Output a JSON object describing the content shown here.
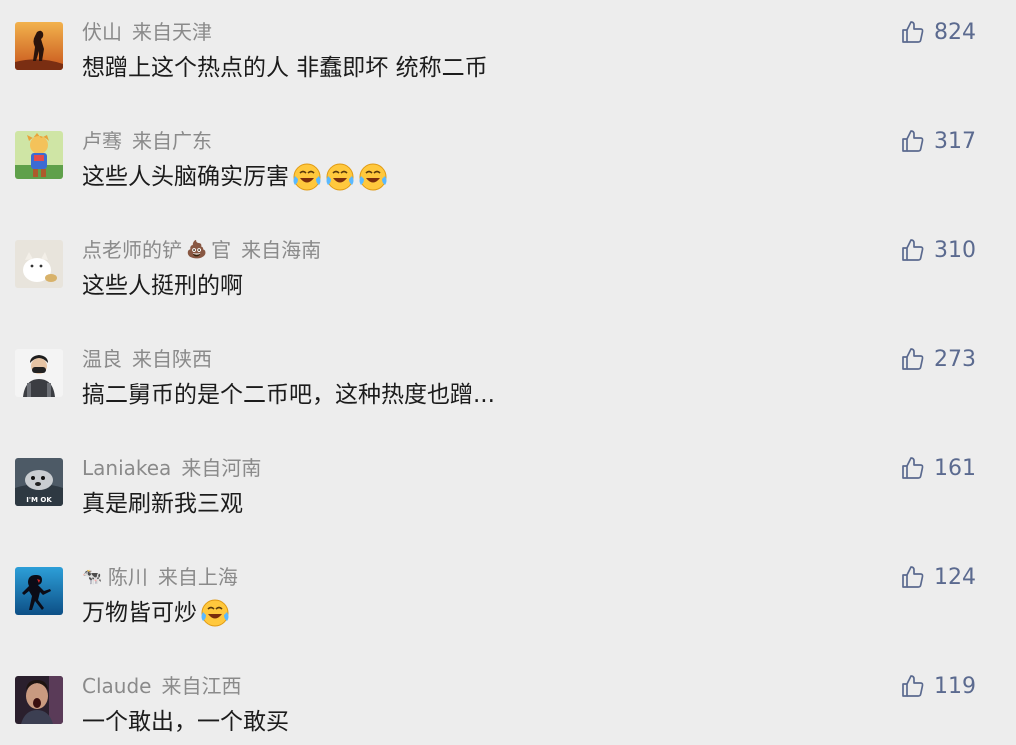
{
  "colors": {
    "background": "#ededed",
    "username": "#8a8a8a",
    "comment_text": "#1c1c1c",
    "like": "#5b6a8f"
  },
  "comments": [
    {
      "username": "伏山",
      "location": "来自天津",
      "text": "想蹭上这个热点的人 非蠢即坏 统称二币",
      "likes": "824",
      "avatar_icon": "desert-silhouette-avatar",
      "emojis": 0
    },
    {
      "username": "卢骞",
      "location": "来自广东",
      "text": "这些人头脑确实厉害",
      "likes": "317",
      "avatar_icon": "anime-character-avatar",
      "emojis": 3
    },
    {
      "username": "点老师的铲",
      "username_icon": "poop-icon",
      "username_suffix": "官",
      "location": "来自海南",
      "text": "这些人挺刑的啊",
      "likes": "310",
      "avatar_icon": "cat-avatar",
      "emojis": 0
    },
    {
      "username": "温良",
      "location": "来自陕西",
      "text": "搞二舅币的是个二币吧，这种热度也蹭...",
      "likes": "273",
      "avatar_icon": "masked-man-avatar",
      "emojis": 0
    },
    {
      "username": "Laniakea",
      "location": "来自河南",
      "text": "真是刷新我三观",
      "likes": "161",
      "avatar_icon": "im-ok-seal-avatar",
      "avatar_text": "I'M OK",
      "emojis": 0
    },
    {
      "username": "陈川",
      "username_icon": "dalmatian-icon",
      "location": "来自上海",
      "text": "万物皆可炒",
      "likes": "124",
      "avatar_icon": "spiderman-avatar",
      "emojis": 1
    },
    {
      "username": "Claude",
      "location": "来自江西",
      "text": "一个敢出，一个敢买",
      "likes": "119",
      "avatar_icon": "shouting-man-avatar",
      "emojis": 0
    }
  ]
}
